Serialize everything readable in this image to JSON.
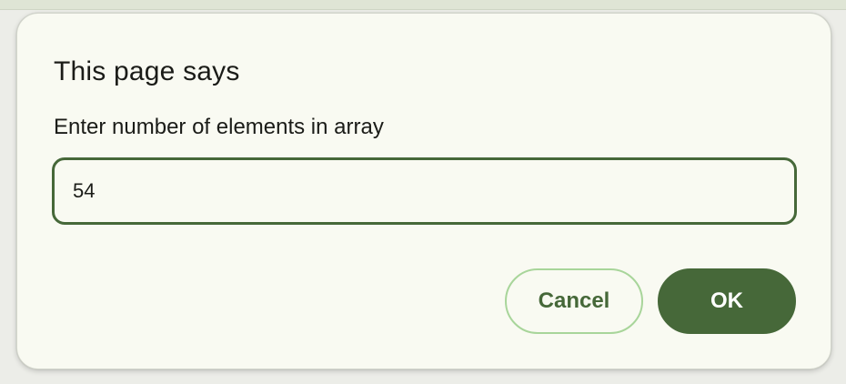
{
  "dialog": {
    "title": "This page says",
    "message": "Enter number of elements in array",
    "input_value": "54",
    "cancel_label": "Cancel",
    "ok_label": "OK"
  },
  "colors": {
    "accent": "#466839",
    "cancel_border": "#a8d59a",
    "dialog_background": "#f9faf2",
    "text": "#1b1c18"
  }
}
